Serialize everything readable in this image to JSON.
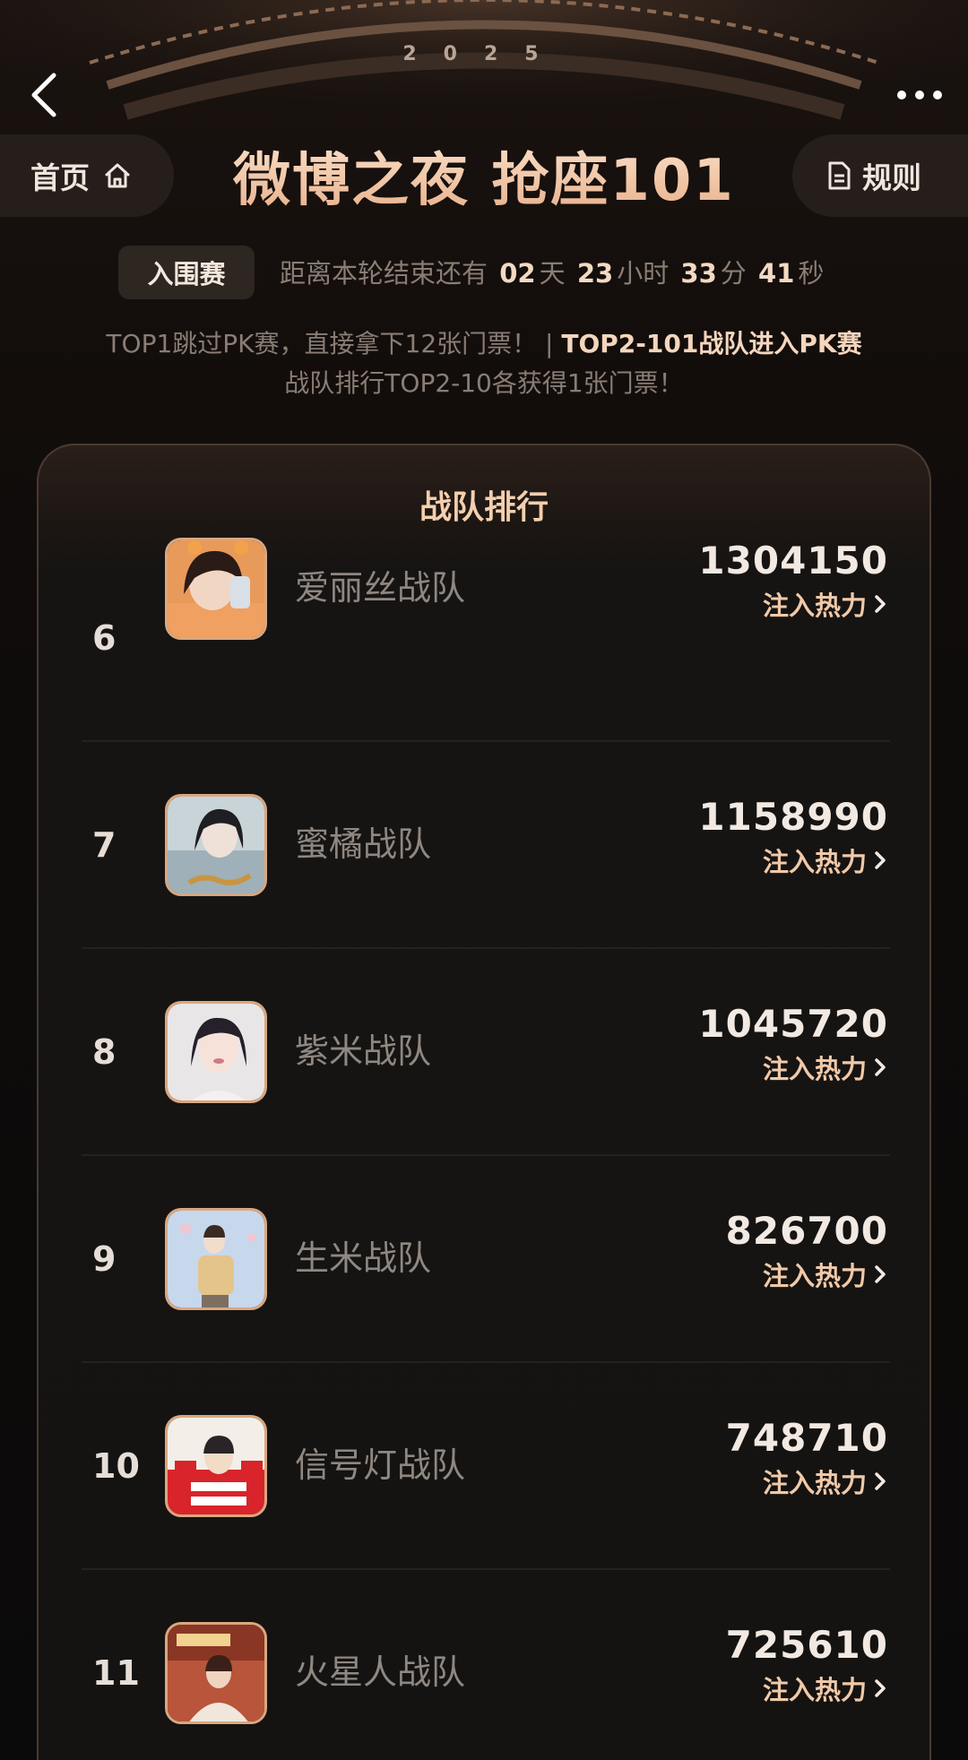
{
  "header": {
    "year": "2025",
    "title": "微博之夜 抢座101",
    "home_label": "首页",
    "rules_label": "规则"
  },
  "round": {
    "badge": "入围赛",
    "countdown_prefix": "距离本轮结束还有",
    "days": "02",
    "days_unit": "天",
    "hours": "23",
    "hours_unit": "小时",
    "minutes": "33",
    "minutes_unit": "分",
    "seconds": "41",
    "seconds_unit": "秒"
  },
  "info": {
    "line1_a": "TOP1跳过PK赛，直接拿下12张门票！ | ",
    "line1_b": "TOP2-101战队进入PK赛",
    "line2": "战队排行TOP2-10各获得1张门票！"
  },
  "ranking": {
    "title": "战队排行",
    "action_label": "注入热力",
    "rows": [
      {
        "rank": "6",
        "name": "爱丽丝战队",
        "score": "1304150"
      },
      {
        "rank": "7",
        "name": "蜜橘战队",
        "score": "1158990"
      },
      {
        "rank": "8",
        "name": "紫米战队",
        "score": "1045720"
      },
      {
        "rank": "9",
        "name": "生米战队",
        "score": "826700"
      },
      {
        "rank": "10",
        "name": "信号灯战队",
        "score": "748710"
      },
      {
        "rank": "11",
        "name": "火星人战队",
        "score": "725610"
      }
    ]
  },
  "colors": {
    "accent": "#f1c9a8",
    "background": "#0d0b0a",
    "card": "#141312"
  }
}
